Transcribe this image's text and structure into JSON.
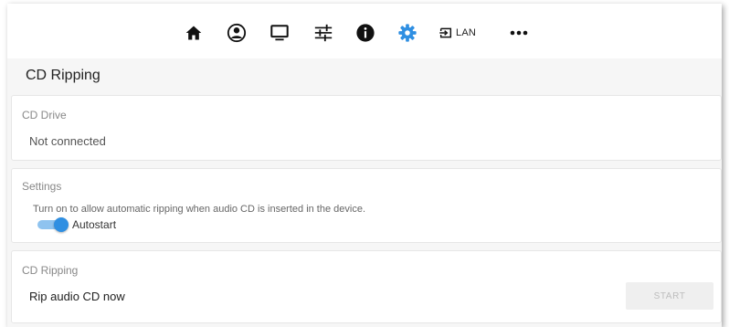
{
  "nav": {
    "items": [
      {
        "icon": "home-icon"
      },
      {
        "icon": "account-icon"
      },
      {
        "icon": "monitor-icon"
      },
      {
        "icon": "equalizer-sliders-icon"
      },
      {
        "icon": "info-icon"
      },
      {
        "icon": "gear-icon",
        "active": true,
        "color": "#2f8fe2"
      },
      {
        "icon": "input-icon",
        "label": "LAN"
      },
      {
        "icon": "more-icon"
      }
    ]
  },
  "page": {
    "title": "CD Ripping"
  },
  "cd_drive": {
    "title": "CD Drive",
    "status": "Not connected"
  },
  "settings": {
    "title": "Settings",
    "description": "Turn on to allow automatic ripping when audio CD is inserted in the device.",
    "autostart_label": "Autostart",
    "autostart_on": true
  },
  "ripping": {
    "title": "CD Ripping",
    "action_label": "Rip audio CD now",
    "start_label": "START"
  },
  "colors": {
    "accent": "#2f8fe2",
    "toggle_track": "#8fc3ef"
  }
}
